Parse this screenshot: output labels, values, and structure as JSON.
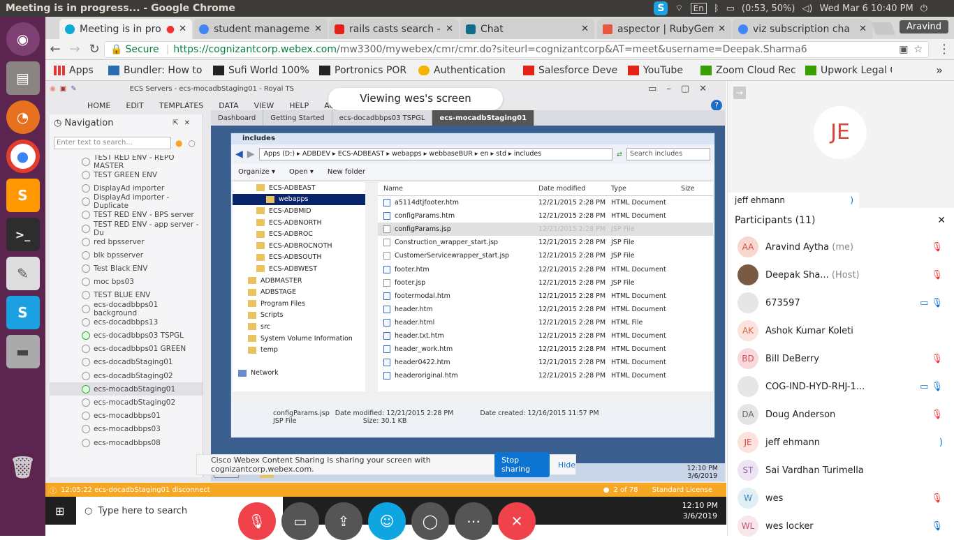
{
  "os": {
    "window_title": "Meeting is in progress... - Google Chrome",
    "tray": {
      "keyboard": "En",
      "battery": "(0:53, 50%)",
      "datetime": "Wed Mar  6 10:40 PM"
    }
  },
  "launcher": {
    "items": [
      "ubuntu",
      "files",
      "firefox",
      "chrome",
      "sublime-text",
      "terminal",
      "text-editor",
      "skype",
      "disk",
      "trash"
    ]
  },
  "browser": {
    "tabs": [
      {
        "label": "Meeting is in pro",
        "active": true
      },
      {
        "label": "student manageme",
        "active": false
      },
      {
        "label": "rails casts search - Y",
        "active": false
      },
      {
        "label": "Chat",
        "active": false
      },
      {
        "label": "aspector | RubyGem",
        "active": false
      },
      {
        "label": "viz subscription cha",
        "active": false
      }
    ],
    "profile": "Aravind",
    "secure_label": "Secure",
    "url_host": "https://cognizantcorp.webex.com",
    "url_path": "/mw3300/mywebex/cmr/cmr.do?siteurl=cognizantcorp&AT=meet&username=Deepak.Sharma6",
    "bookmarks": [
      "Apps",
      "Bundler: How to",
      "Sufi World 100%",
      "Portronics POR",
      "Authentication",
      "Salesforce Deve",
      "YouTube",
      "Zoom Cloud Rec",
      "Upwork Legal C"
    ]
  },
  "royal": {
    "title": "ECS Servers - ecs-mocadbStaging01 - Royal TS",
    "menu": [
      "HOME",
      "EDIT",
      "TEMPLATES",
      "DATA",
      "VIEW",
      "HELP",
      "ACTIONS"
    ],
    "viewing": "Viewing wes's screen",
    "nav_title": "Navigation",
    "nav_search_placeholder": "Enter text to search...",
    "nav_items": [
      "TEST RED ENV - REPO MASTER",
      "TEST GREEN ENV",
      "DisplayAd importer",
      "DisplayAd importer - Duplicate",
      "TEST RED ENV - BPS server",
      "TEST RED ENV - app server - Du",
      "red bpsserver",
      "blk bpsserver",
      "Test Black ENV",
      "moc bps03",
      "TEST BLUE ENV",
      "ecs-docadbbps01 background",
      "ecs-docadbbps13",
      "ecs-docadbbps03 TSPGL",
      "ecs-docadbbps01 GREEN",
      "ecs-docadbStaging01",
      "ecs-docadbStaging02",
      "ecs-mocadbStaging01",
      "ecs-mocadbStaging02",
      "ecs-mocadbbps01",
      "ecs-mocadbbps03",
      "ecs-mocadbbps08"
    ],
    "remote_tabs": [
      "Dashboard",
      "Getting Started",
      "ecs-docadbbps03 TSPGL",
      "ecs-mocadbStaging01"
    ],
    "status_text": "12:05:22 ecs-docadbStaging01 disconnect",
    "page_count": "2 of 78",
    "license": "Standard License"
  },
  "explorer": {
    "title": "includes",
    "breadcrumb": "Apps (D:) ▸ ADBDEV ▸ ECS-ADBEAST ▸ webapps ▸ webbaseBUR ▸ en ▸ std ▸ includes",
    "search_placeholder": "Search includes",
    "toolbar": [
      "Organize ▾",
      "Open ▾",
      "New folder"
    ],
    "tree": [
      {
        "label": "ECS-ADBEAST",
        "indent": 2
      },
      {
        "label": "webapps",
        "indent": 3,
        "selected": true
      },
      {
        "label": "ECS-ADBMID",
        "indent": 2
      },
      {
        "label": "ECS-ADBNORTH",
        "indent": 2
      },
      {
        "label": "ECS-ADBROC",
        "indent": 2
      },
      {
        "label": "ECS-ADBROCNOTH",
        "indent": 2
      },
      {
        "label": "ECS-ADBSOUTH",
        "indent": 2
      },
      {
        "label": "ECS-ADBWEST",
        "indent": 2
      },
      {
        "label": "ADBMASTER",
        "indent": 1
      },
      {
        "label": "ADBSTAGE",
        "indent": 1
      },
      {
        "label": "Program Files",
        "indent": 1
      },
      {
        "label": "Scripts",
        "indent": 1
      },
      {
        "label": "src",
        "indent": 1
      },
      {
        "label": "System Volume Information",
        "indent": 1
      },
      {
        "label": "temp",
        "indent": 1
      },
      {
        "label": "",
        "indent": 0
      },
      {
        "label": "Network",
        "indent": 0
      }
    ],
    "columns": [
      "Name",
      "Date modified",
      "Type",
      "Size"
    ],
    "files": [
      {
        "name": "a5114dtjfooter.htm",
        "date": "12/21/2015 2:28 PM",
        "type": "HTML Document"
      },
      {
        "name": "configParams.htm",
        "date": "12/21/2015 2:28 PM",
        "type": "HTML Document"
      },
      {
        "name": "configParams.jsp",
        "date": "12/21/2015 2:28 PM",
        "type": "JSP File"
      },
      {
        "name": "Construction_wrapper_start.jsp",
        "date": "12/21/2015 2:28 PM",
        "type": "JSP File"
      },
      {
        "name": "CustomerServicewrapper_start.jsp",
        "date": "12/21/2015 2:28 PM",
        "type": "JSP File"
      },
      {
        "name": "footer.htm",
        "date": "12/21/2015 2:28 PM",
        "type": "HTML Document"
      },
      {
        "name": "footer.jsp",
        "date": "12/21/2015 2:28 PM",
        "type": "JSP File"
      },
      {
        "name": "footermodal.htm",
        "date": "12/21/2015 2:28 PM",
        "type": "HTML Document"
      },
      {
        "name": "header.htm",
        "date": "12/21/2015 2:28 PM",
        "type": "HTML Document"
      },
      {
        "name": "header.html",
        "date": "12/21/2015 2:28 PM",
        "type": "HTML File"
      },
      {
        "name": "header.txt.htm",
        "date": "12/21/2015 2:28 PM",
        "type": "HTML Document"
      },
      {
        "name": "header_work.htm",
        "date": "12/21/2015 2:28 PM",
        "type": "HTML Document"
      },
      {
        "name": "header0422.htm",
        "date": "12/21/2015 2:28 PM",
        "type": "HTML Document"
      },
      {
        "name": "headeroriginal.htm",
        "date": "12/21/2015 2:28 PM",
        "type": "HTML Document"
      }
    ],
    "details": {
      "name": "configParams.jsp",
      "kind": "JSP File",
      "modified": "Date modified: 12/21/2015 2:28 PM",
      "size": "Size: 30.1 KB",
      "created": "Date created: 12/16/2015 11:57 PM"
    },
    "start": "Start",
    "clock_time": "12:10 PM",
    "clock_date": "3/6/2019"
  },
  "webex": {
    "share_notice": "Cisco Webex Content Sharing is sharing your screen with cognizantcorp.webex.com.",
    "stop_sharing": "Stop sharing",
    "hide": "Hide",
    "win_search_placeholder": "Type here to search",
    "win_time": "12:10 PM",
    "win_date": "3/6/2019",
    "video_initials": "JE",
    "video_name": "jeff ehmann",
    "participants_title": "Participants (11)",
    "participants": [
      {
        "initials": "AA",
        "name": "Aravind Aytha",
        "role": "(me)",
        "icon": "mic-muted",
        "color": "#f8d7cf",
        "fg": "#c9543f"
      },
      {
        "initials": "",
        "name": "Deepak Sha...",
        "role": "(Host)",
        "icon": "mic-muted",
        "color": "#7a5a42",
        "fg": "#fff"
      },
      {
        "initials": "",
        "name": "673597",
        "role": "",
        "icon": "video-mic",
        "color": "#e6e6e6",
        "fg": "#999"
      },
      {
        "initials": "AK",
        "name": "Ashok Kumar Koleti",
        "role": "",
        "icon": "",
        "color": "#fbe2dc",
        "fg": "#d9613f"
      },
      {
        "initials": "BD",
        "name": "Bill DeBerry",
        "role": "",
        "icon": "mic-muted",
        "color": "#f7d8dc",
        "fg": "#d5505c"
      },
      {
        "initials": "",
        "name": "COG-IND-HYD-RHJ-1...",
        "role": "",
        "icon": "video-mic",
        "color": "#e6e6e6",
        "fg": "#999"
      },
      {
        "initials": "DA",
        "name": "Doug Anderson",
        "role": "",
        "icon": "mic-muted",
        "color": "#e4e4e4",
        "fg": "#666"
      },
      {
        "initials": "JE",
        "name": "jeff ehmann",
        "role": "",
        "icon": "speaking",
        "color": "#fbe2dc",
        "fg": "#d9453a"
      },
      {
        "initials": "ST",
        "name": "Sai Vardhan Turimella",
        "role": "",
        "icon": "",
        "color": "#ece4f3",
        "fg": "#8a62a8"
      },
      {
        "initials": "W",
        "name": "wes",
        "role": "",
        "icon": "mic-muted",
        "color": "#e0eef6",
        "fg": "#3b86b8"
      },
      {
        "initials": "WL",
        "name": "wes locker",
        "role": "",
        "icon": "mic",
        "color": "#f7e6ea",
        "fg": "#c45873"
      }
    ]
  }
}
